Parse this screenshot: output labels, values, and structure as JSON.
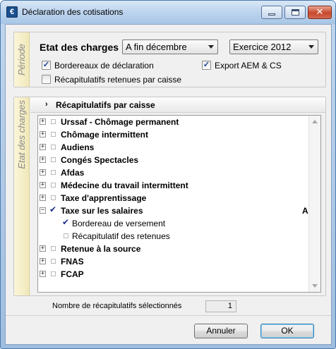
{
  "window": {
    "title": "Déclaration des cotisations",
    "app_icon_glyph": "€"
  },
  "periode": {
    "tab_label": "Période",
    "etat_label": "Etat des charges",
    "period_select": "A fin décembre",
    "exercise_select": "Exercice 2012",
    "checkboxes": [
      {
        "label": "Bordereaux de déclaration",
        "checked": true
      },
      {
        "label": "Export AEM & CS",
        "checked": true
      },
      {
        "label": "Récapitulatifs retenues par caisse",
        "checked": false
      }
    ]
  },
  "etat": {
    "tab_label": "Etat des charges",
    "section_title": "Récapitulatifs par caisse",
    "tree": [
      {
        "label": "Urssaf - Chômage permanent",
        "expander": "+",
        "bold": true
      },
      {
        "label": "Chômage intermittent",
        "expander": "+",
        "bold": true
      },
      {
        "label": "Audiens",
        "expander": "+",
        "bold": true
      },
      {
        "label": "Congés Spectacles",
        "expander": "+",
        "bold": true
      },
      {
        "label": "Afdas",
        "expander": "+",
        "bold": true
      },
      {
        "label": "Médecine du travail intermittent",
        "expander": "+",
        "bold": true
      },
      {
        "label": "Taxe d'apprentissage",
        "expander": "+",
        "bold": true
      },
      {
        "label": "Taxe sur les salaires",
        "expander": "−",
        "bold": true,
        "checked": true,
        "badge": "A"
      },
      {
        "label": "Bordereau de versement",
        "child": true,
        "checked": true
      },
      {
        "label": "Récapitulatif des retenues",
        "child": true,
        "checked": false
      },
      {
        "label": "Retenue à la source",
        "expander": "+",
        "bold": true
      },
      {
        "label": "FNAS",
        "expander": "+",
        "bold": true
      },
      {
        "label": "FCAP",
        "expander": "+",
        "bold": true
      }
    ]
  },
  "footer": {
    "count_label": "Nombre de récapitulatifs sélectionnés",
    "count_value": "1",
    "cancel_label": "Annuler",
    "ok_label": "OK"
  }
}
